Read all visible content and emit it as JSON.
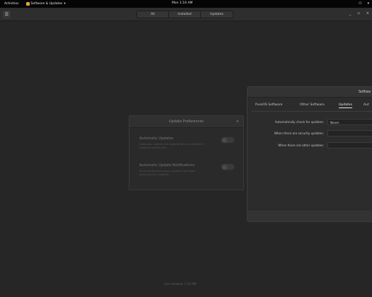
{
  "topbar": {
    "activities": "Activities",
    "app_menu": "Software & Updates",
    "app_menu_arrow": "▾",
    "clock": "Mon 1:16 AM",
    "tray": [
      "⚇",
      "▾"
    ]
  },
  "header": {
    "menu_icon": "☰",
    "tabs": [
      {
        "label": "All"
      },
      {
        "label": "Installed"
      },
      {
        "label": "Updates"
      }
    ],
    "window_controls": [
      "_",
      "▫",
      "×"
    ]
  },
  "footer": {
    "last_checked": "Last checked: 1:16 AM"
  },
  "dialog": {
    "title": "Update Preferences",
    "close": "×",
    "prefs": [
      {
        "title": "Automatic Updates",
        "desc": "Automatic updates are disabled when on mobile or metered connections."
      },
      {
        "title": "Automatic Update Notifications",
        "desc": "Show notifications when updates have been automatically installed."
      }
    ]
  },
  "software_window": {
    "title": "Softwa",
    "tabs": [
      "PureOS Software",
      "Other Software",
      "Updates",
      "Aut"
    ],
    "active_tab": "Updates",
    "rows": [
      {
        "label": "Automatically check for updates:",
        "value": "Never"
      },
      {
        "label": "When there are security updates:",
        "value": ""
      },
      {
        "label": "When there are other updates:",
        "value": ""
      }
    ]
  }
}
